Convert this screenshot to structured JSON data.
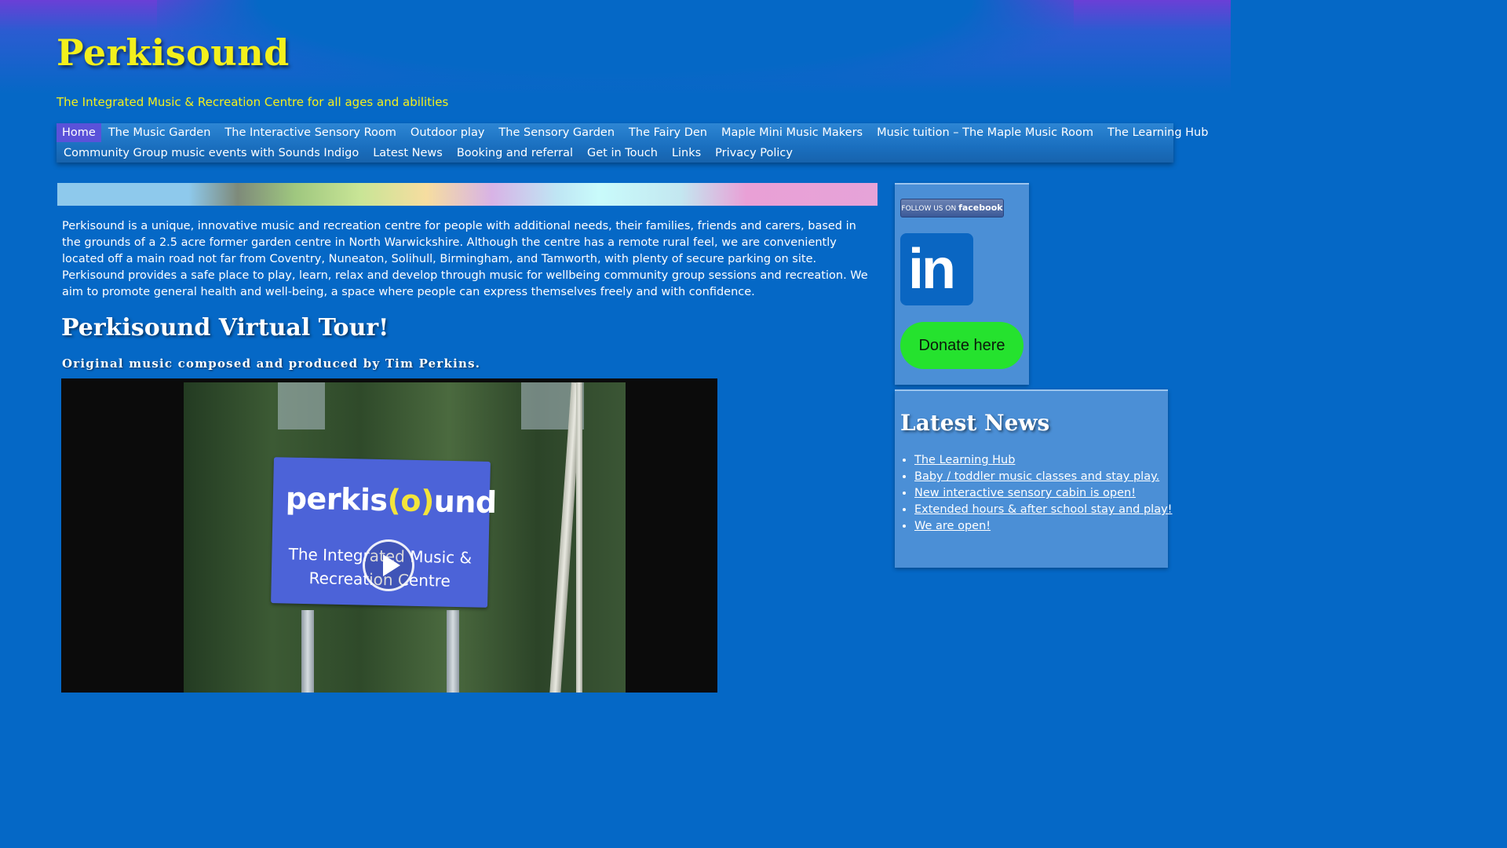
{
  "site": {
    "title": "Perkisound",
    "tagline": "The Integrated Music & Recreation Centre for all ages and abilities"
  },
  "nav": {
    "row1": [
      "Home",
      "The Music Garden",
      "The Interactive Sensory Room",
      "Outdoor play",
      "The Sensory Garden",
      "The Fairy Den",
      "Maple Mini Music Makers",
      "Music tuition – The Maple Music Room",
      "The Learning Hub"
    ],
    "row2": [
      "Community Group music events with Sounds Indigo",
      "Latest News",
      "Booking and referral",
      "Get in Touch",
      "Links",
      "Privacy Policy"
    ],
    "active": "Home"
  },
  "main": {
    "intro": "Perkisound is a unique, innovative music and recreation centre for people with additional needs, their families, friends and carers, based in the grounds of a 2.5 acre former garden centre in North Warwickshire. Although the centre has a remote rural feel, we are conveniently located off a main road not far from Coventry, Nuneaton, Solihull, Birmingham, and Tamworth, with plenty of secure parking on site. Perkisound provides a safe place to play, learn, relax and develop through music for wellbeing community group sessions and recreation. We aim to promote general health and well-being, a space where people can express themselves freely and with confidence.",
    "tour_title": "Perkisound Virtual Tour!",
    "tour_subtitle": "Original music composed and produced by Tim Perkins.",
    "video": {
      "sign_logo_left": "perkis",
      "sign_logo_o": "(o)",
      "sign_logo_right": "und",
      "sign_line1": "The Integrated Music &",
      "sign_line2": "Recreation Centre",
      "play_icon": "play-icon"
    }
  },
  "sidebar": {
    "facebook": {
      "prefix": "FOLLOW US ON",
      "brand": "facebook"
    },
    "linkedin": {
      "text": "in",
      "icon": "linkedin-icon"
    },
    "donate_label": "Donate here",
    "latest_news": {
      "title": "Latest News",
      "items": [
        "The Learning Hub",
        "Baby / toddler music classes and stay play.",
        "New interactive sensory cabin is open!",
        "Extended hours & after school stay and play!",
        "We are open!"
      ]
    }
  },
  "colors": {
    "background": "#0568c6",
    "title_yellow": "#f3f01c",
    "nav_active": "#5a52d9",
    "widget_bg": "#4b8fd6",
    "donate_green": "#25e22e",
    "linkedin_blue": "#0a66c2",
    "facebook_blue": "#3b5998"
  }
}
